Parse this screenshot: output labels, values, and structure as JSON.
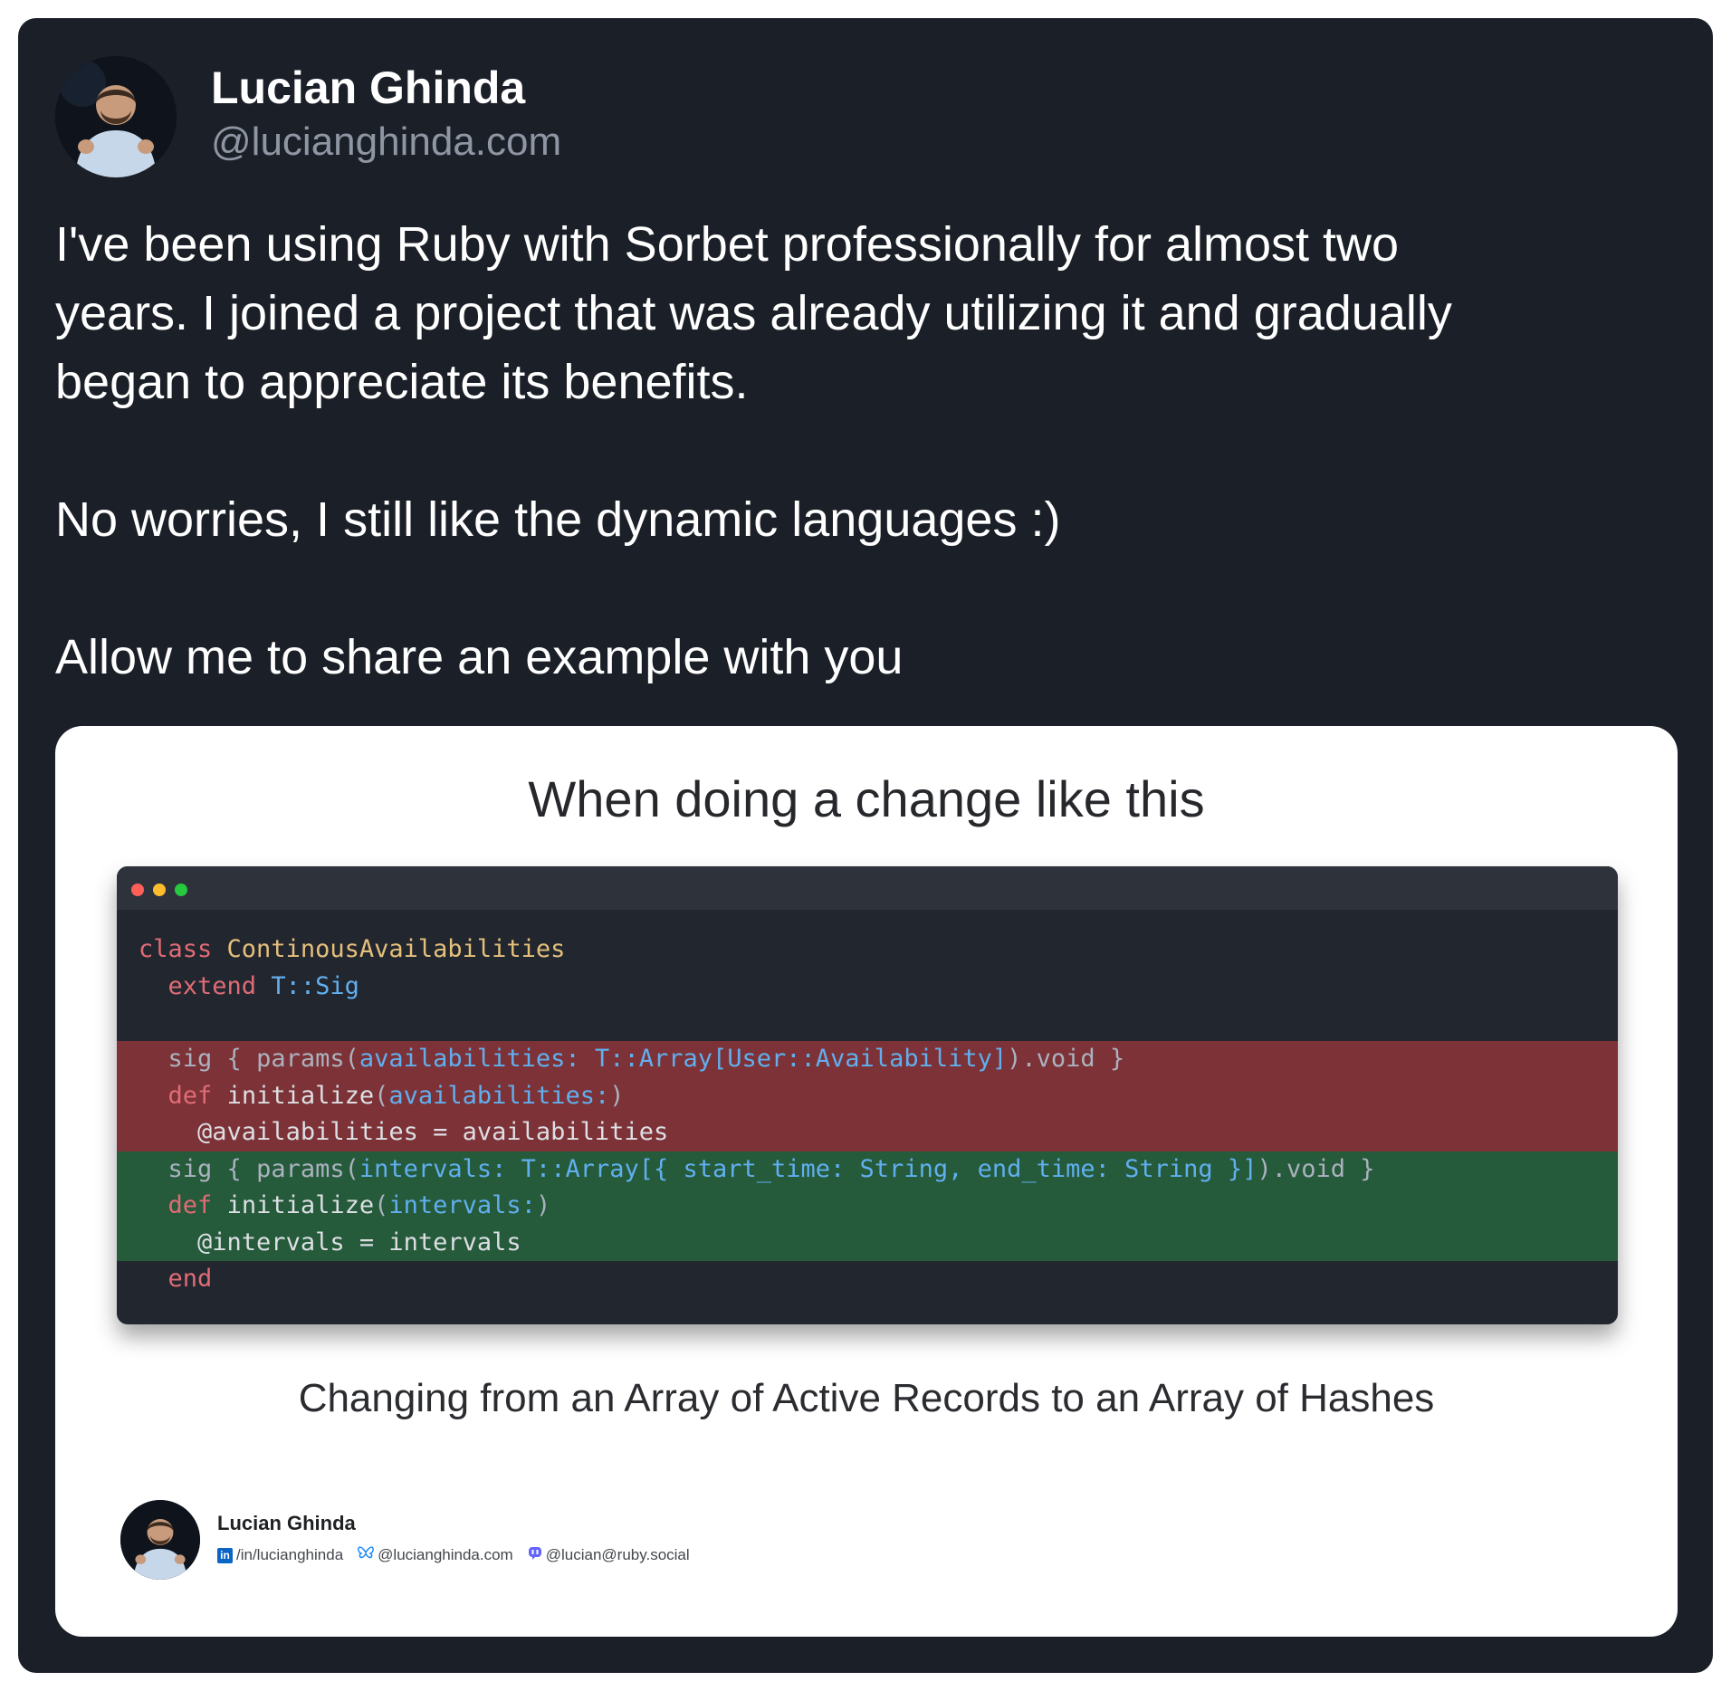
{
  "post": {
    "author_name": "Lucian Ghinda",
    "author_handle": "@lucianghinda.com",
    "paragraphs": [
      "I've been using Ruby with Sorbet professionally for almost two",
      "years. I joined a project that was already utilizing it and gradually",
      "began to appreciate its benefits.",
      "No worries, I still like the dynamic languages :)",
      "Allow me to share an example with you"
    ]
  },
  "card": {
    "title": "When doing a change like this",
    "caption": "Changing from an Array of Active Records to an Array of Hashes",
    "author_name": "Lucian Ghinda",
    "links": {
      "linkedin": "/in/lucianghinda",
      "bluesky": "@lucianghinda.com",
      "mastodon": "@lucian@ruby.social"
    }
  },
  "code": {
    "c1_kw": "class",
    "c1_name": "ContinousAvailabilities",
    "c2_kw": "extend",
    "c2_mod": "T::",
    "c2_sig": "Sig",
    "d1_sig": "sig",
    "d1_a": " { params(",
    "d1_b": "availabilities:",
    "d1_c": " T::Array[User::Availability]",
    "d1_d": ").void }",
    "d2_kw": "def",
    "d2_fn": "initialize",
    "d2_p": "(",
    "d2_arg": "availabilities:",
    "d2_e": ")",
    "d3_text": "@availabilities = availabilities",
    "a1_sig": "sig",
    "a1_a": " { params(",
    "a1_b": "intervals:",
    "a1_c": " T::Array[{ start_time: String, end_time: String }]",
    "a1_d": ").void }",
    "a2_kw": "def",
    "a2_fn": "initialize",
    "a2_p": "(",
    "a2_arg": "intervals:",
    "a2_e": ")",
    "a3_text": "@intervals = intervals",
    "end_kw": "end"
  },
  "colors": {
    "post_background": "#1b1f27",
    "removed_line": "#7c3236",
    "added_line": "#255a3a"
  }
}
